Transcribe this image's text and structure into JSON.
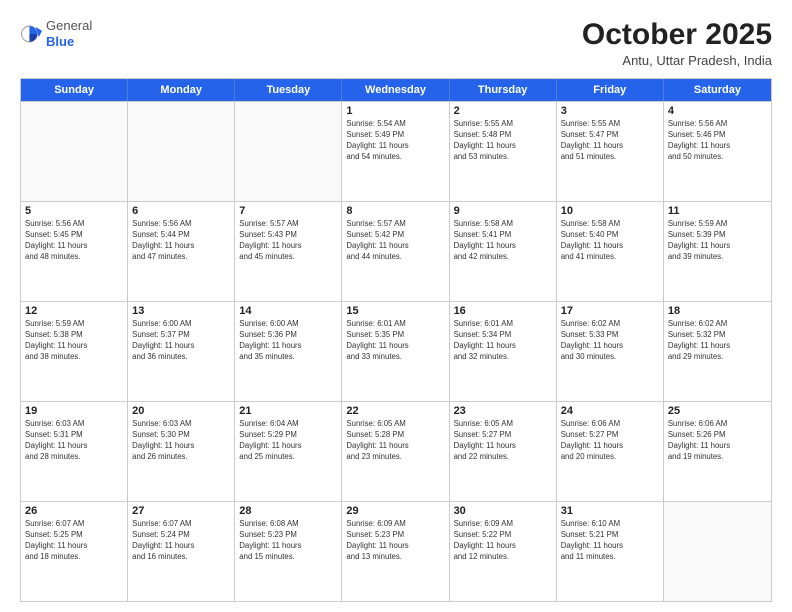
{
  "header": {
    "logo_general": "General",
    "logo_blue": "Blue",
    "month_title": "October 2025",
    "subtitle": "Antu, Uttar Pradesh, India"
  },
  "day_headers": [
    "Sunday",
    "Monday",
    "Tuesday",
    "Wednesday",
    "Thursday",
    "Friday",
    "Saturday"
  ],
  "weeks": [
    [
      {
        "date": "",
        "info": "",
        "empty": true
      },
      {
        "date": "",
        "info": "",
        "empty": true
      },
      {
        "date": "",
        "info": "",
        "empty": true
      },
      {
        "date": "1",
        "info": "Sunrise: 5:54 AM\nSunset: 5:49 PM\nDaylight: 11 hours\nand 54 minutes.",
        "empty": false
      },
      {
        "date": "2",
        "info": "Sunrise: 5:55 AM\nSunset: 5:48 PM\nDaylight: 11 hours\nand 53 minutes.",
        "empty": false
      },
      {
        "date": "3",
        "info": "Sunrise: 5:55 AM\nSunset: 5:47 PM\nDaylight: 11 hours\nand 51 minutes.",
        "empty": false
      },
      {
        "date": "4",
        "info": "Sunrise: 5:56 AM\nSunset: 5:46 PM\nDaylight: 11 hours\nand 50 minutes.",
        "empty": false
      }
    ],
    [
      {
        "date": "5",
        "info": "Sunrise: 5:56 AM\nSunset: 5:45 PM\nDaylight: 11 hours\nand 48 minutes.",
        "empty": false
      },
      {
        "date": "6",
        "info": "Sunrise: 5:56 AM\nSunset: 5:44 PM\nDaylight: 11 hours\nand 47 minutes.",
        "empty": false
      },
      {
        "date": "7",
        "info": "Sunrise: 5:57 AM\nSunset: 5:43 PM\nDaylight: 11 hours\nand 45 minutes.",
        "empty": false
      },
      {
        "date": "8",
        "info": "Sunrise: 5:57 AM\nSunset: 5:42 PM\nDaylight: 11 hours\nand 44 minutes.",
        "empty": false
      },
      {
        "date": "9",
        "info": "Sunrise: 5:58 AM\nSunset: 5:41 PM\nDaylight: 11 hours\nand 42 minutes.",
        "empty": false
      },
      {
        "date": "10",
        "info": "Sunrise: 5:58 AM\nSunset: 5:40 PM\nDaylight: 11 hours\nand 41 minutes.",
        "empty": false
      },
      {
        "date": "11",
        "info": "Sunrise: 5:59 AM\nSunset: 5:39 PM\nDaylight: 11 hours\nand 39 minutes.",
        "empty": false
      }
    ],
    [
      {
        "date": "12",
        "info": "Sunrise: 5:59 AM\nSunset: 5:38 PM\nDaylight: 11 hours\nand 38 minutes.",
        "empty": false
      },
      {
        "date": "13",
        "info": "Sunrise: 6:00 AM\nSunset: 5:37 PM\nDaylight: 11 hours\nand 36 minutes.",
        "empty": false
      },
      {
        "date": "14",
        "info": "Sunrise: 6:00 AM\nSunset: 5:36 PM\nDaylight: 11 hours\nand 35 minutes.",
        "empty": false
      },
      {
        "date": "15",
        "info": "Sunrise: 6:01 AM\nSunset: 5:35 PM\nDaylight: 11 hours\nand 33 minutes.",
        "empty": false
      },
      {
        "date": "16",
        "info": "Sunrise: 6:01 AM\nSunset: 5:34 PM\nDaylight: 11 hours\nand 32 minutes.",
        "empty": false
      },
      {
        "date": "17",
        "info": "Sunrise: 6:02 AM\nSunset: 5:33 PM\nDaylight: 11 hours\nand 30 minutes.",
        "empty": false
      },
      {
        "date": "18",
        "info": "Sunrise: 6:02 AM\nSunset: 5:32 PM\nDaylight: 11 hours\nand 29 minutes.",
        "empty": false
      }
    ],
    [
      {
        "date": "19",
        "info": "Sunrise: 6:03 AM\nSunset: 5:31 PM\nDaylight: 11 hours\nand 28 minutes.",
        "empty": false
      },
      {
        "date": "20",
        "info": "Sunrise: 6:03 AM\nSunset: 5:30 PM\nDaylight: 11 hours\nand 26 minutes.",
        "empty": false
      },
      {
        "date": "21",
        "info": "Sunrise: 6:04 AM\nSunset: 5:29 PM\nDaylight: 11 hours\nand 25 minutes.",
        "empty": false
      },
      {
        "date": "22",
        "info": "Sunrise: 6:05 AM\nSunset: 5:28 PM\nDaylight: 11 hours\nand 23 minutes.",
        "empty": false
      },
      {
        "date": "23",
        "info": "Sunrise: 6:05 AM\nSunset: 5:27 PM\nDaylight: 11 hours\nand 22 minutes.",
        "empty": false
      },
      {
        "date": "24",
        "info": "Sunrise: 6:06 AM\nSunset: 5:27 PM\nDaylight: 11 hours\nand 20 minutes.",
        "empty": false
      },
      {
        "date": "25",
        "info": "Sunrise: 6:06 AM\nSunset: 5:26 PM\nDaylight: 11 hours\nand 19 minutes.",
        "empty": false
      }
    ],
    [
      {
        "date": "26",
        "info": "Sunrise: 6:07 AM\nSunset: 5:25 PM\nDaylight: 11 hours\nand 18 minutes.",
        "empty": false
      },
      {
        "date": "27",
        "info": "Sunrise: 6:07 AM\nSunset: 5:24 PM\nDaylight: 11 hours\nand 16 minutes.",
        "empty": false
      },
      {
        "date": "28",
        "info": "Sunrise: 6:08 AM\nSunset: 5:23 PM\nDaylight: 11 hours\nand 15 minutes.",
        "empty": false
      },
      {
        "date": "29",
        "info": "Sunrise: 6:09 AM\nSunset: 5:23 PM\nDaylight: 11 hours\nand 13 minutes.",
        "empty": false
      },
      {
        "date": "30",
        "info": "Sunrise: 6:09 AM\nSunset: 5:22 PM\nDaylight: 11 hours\nand 12 minutes.",
        "empty": false
      },
      {
        "date": "31",
        "info": "Sunrise: 6:10 AM\nSunset: 5:21 PM\nDaylight: 11 hours\nand 11 minutes.",
        "empty": false
      },
      {
        "date": "",
        "info": "",
        "empty": true
      }
    ]
  ]
}
